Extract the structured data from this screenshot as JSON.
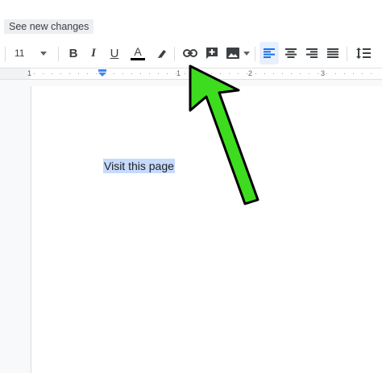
{
  "header": {
    "see_new_changes": "See new changes"
  },
  "toolbar": {
    "font_size": "11",
    "bold": "B",
    "italic": "I",
    "underline": "U",
    "text_color_letter": "A",
    "text_color": "#000000",
    "active_tool": "insert-link",
    "alignment": "left"
  },
  "ruler": {
    "labels": [
      "1",
      "1",
      "2",
      "3"
    ]
  },
  "document": {
    "selected_text": "Visit this page",
    "selection_color": "#c6dafc"
  },
  "annotation": {
    "arrow_color": "#3ddc1f",
    "arrow_outline": "#000000",
    "points_to": "insert-link-icon"
  },
  "colors": {
    "accent": "#1a73e8",
    "toolbar_icon": "#3c4043"
  }
}
